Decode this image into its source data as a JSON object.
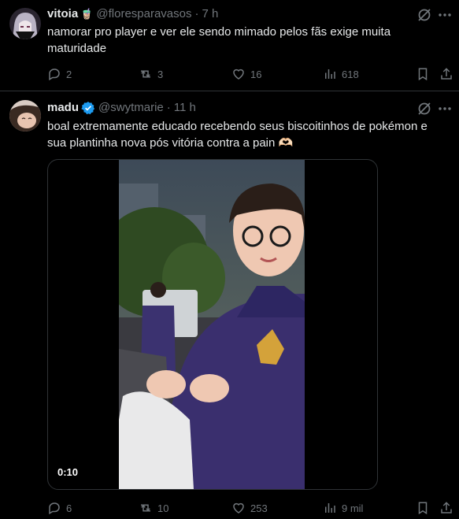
{
  "tweets": [
    {
      "name": "vitoia",
      "name_emoji": "🧋",
      "handle": "@floresparavasos",
      "separator": "·",
      "time": "7 h",
      "text": "namorar pro player e ver ele sendo mimado pelos fãs exige muita maturidade",
      "replies": "2",
      "reposts": "3",
      "likes": "16",
      "views": "618",
      "verified": false
    },
    {
      "name": "madu",
      "handle": "@swytmarie",
      "separator": "·",
      "time": "11 h",
      "text": "boal extremamente educado recebendo seus biscoitinhos de pokémon e sua plantinha nova pós vitória contra a pain 🫶🏻",
      "video_duration": "0:10",
      "replies": "6",
      "reposts": "10",
      "likes": "253",
      "views": "9 mil",
      "verified": true
    }
  ],
  "icons": {
    "reply": "reply-icon",
    "repost": "repost-icon",
    "like": "heart-icon",
    "views": "views-icon",
    "bookmark": "bookmark-icon",
    "share": "share-icon",
    "grok": "grok-icon",
    "more": "more-icon",
    "verified": "verified-badge-icon"
  },
  "colors": {
    "background": "#000000",
    "text_primary": "#e7e9ea",
    "text_secondary": "#71767b",
    "divider": "#2f3336",
    "verified_blue": "#1d9bf0"
  }
}
